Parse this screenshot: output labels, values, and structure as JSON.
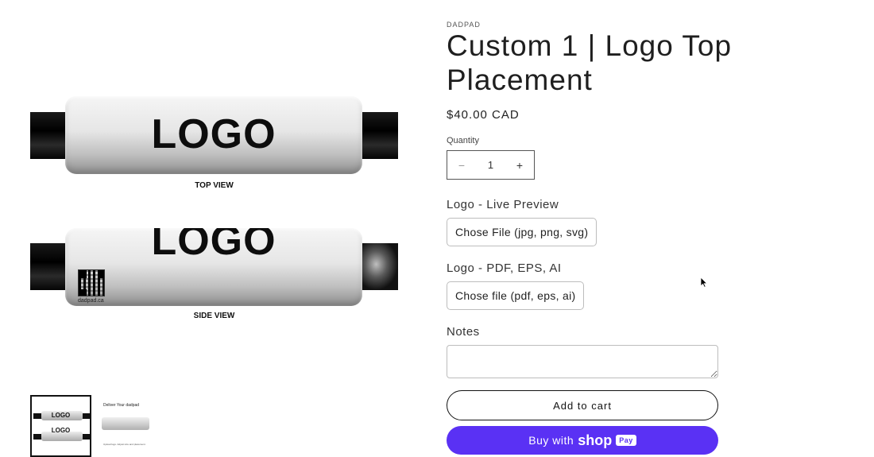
{
  "gallery": {
    "top_product": {
      "logo": "LOGO",
      "label": "TOP VIEW"
    },
    "side_product": {
      "logo": "LOGO",
      "label": "SIDE VIEW",
      "qr_caption": "dadpad.ca"
    },
    "thumbnails": [
      {
        "logo_top": "LOGO",
        "logo_bottom": "LOGO"
      },
      {
        "title": "Deliver Your dadpad",
        "footer": "Upload logo. Adjust size and placement."
      }
    ]
  },
  "product": {
    "vendor": "DADPAD",
    "title": "Custom 1 | Logo Top Placement",
    "price": "$40.00 CAD"
  },
  "quantity": {
    "label": "Quantity",
    "minus": "−",
    "value": "1",
    "plus": "+"
  },
  "uploads": {
    "preview_label": "Logo - Live Preview",
    "preview_button": "Chose File (jpg, png, svg)",
    "vector_label": "Logo - PDF, EPS, AI",
    "vector_button": "Chose file (pdf, eps, ai)"
  },
  "notes": {
    "label": "Notes",
    "value": ""
  },
  "actions": {
    "add_to_cart": "Add to cart",
    "buy_prefix": "Buy with",
    "buy_shop": "shop",
    "buy_pay": "Pay"
  },
  "colors": {
    "shop_pay": "#5a31f4",
    "text": "#121212"
  }
}
